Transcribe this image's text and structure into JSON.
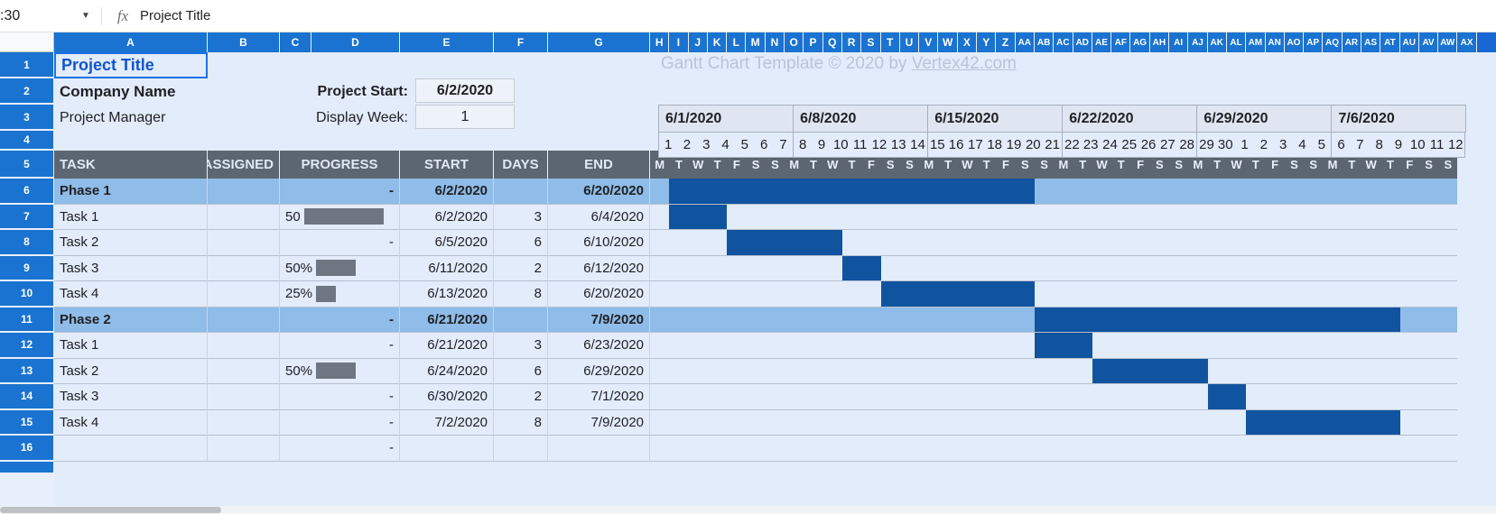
{
  "formula_bar": {
    "name_box": ":30",
    "dropdown_icon": "chevron-down-icon",
    "fx_icon": "fx-icon",
    "content": "Project Title"
  },
  "columns": [
    "A",
    "B",
    "C",
    "D",
    "E",
    "F",
    "G",
    "H",
    "I",
    "J",
    "K",
    "L",
    "M",
    "N",
    "O",
    "P",
    "Q",
    "R",
    "S",
    "T",
    "U",
    "V",
    "W",
    "X",
    "Y",
    "Z",
    "AA",
    "AB",
    "AC",
    "AD",
    "AE",
    "AF",
    "AG",
    "AH",
    "AI",
    "AJ",
    "AK",
    "AL",
    "AM",
    "AN",
    "AO",
    "AP",
    "AQ",
    "AR",
    "AS",
    "AT",
    "AU",
    "AV",
    "AW",
    "AX"
  ],
  "rows": [
    "1",
    "2",
    "3",
    "4",
    "5",
    "6",
    "7",
    "8",
    "9",
    "10",
    "11",
    "12",
    "13",
    "14",
    "15",
    "16"
  ],
  "watermark": {
    "prefix": "Gantt Chart Template © 2020 by ",
    "link": "Vertex42.com"
  },
  "header_block": {
    "project_title": "Project Title",
    "company_name": "Company Name",
    "project_manager": "Project Manager",
    "project_start_label": "Project Start:",
    "project_start_value": "6/2/2020",
    "display_week_label": "Display Week:",
    "display_week_value": "1"
  },
  "table_headers": {
    "task": "TASK",
    "assigned": "ASSIGNED",
    "progress": "PROGRESS",
    "start": "START",
    "days": "DAYS",
    "end": "END"
  },
  "weeks": [
    {
      "label": "6/1/2020",
      "days": [
        "1",
        "2",
        "3",
        "4",
        "5",
        "6",
        "7"
      ],
      "dow": [
        "M",
        "T",
        "W",
        "T",
        "F",
        "S",
        "S"
      ]
    },
    {
      "label": "6/8/2020",
      "days": [
        "8",
        "9",
        "10",
        "11",
        "12",
        "13",
        "14"
      ],
      "dow": [
        "M",
        "T",
        "W",
        "T",
        "F",
        "S",
        "S"
      ]
    },
    {
      "label": "6/15/2020",
      "days": [
        "15",
        "16",
        "17",
        "18",
        "19",
        "20",
        "21"
      ],
      "dow": [
        "M",
        "T",
        "W",
        "T",
        "F",
        "S",
        "S"
      ]
    },
    {
      "label": "6/22/2020",
      "days": [
        "22",
        "23",
        "24",
        "25",
        "26",
        "27",
        "28"
      ],
      "dow": [
        "M",
        "T",
        "W",
        "T",
        "F",
        "S",
        "S"
      ]
    },
    {
      "label": "6/29/2020",
      "days": [
        "29",
        "30",
        "1",
        "2",
        "3",
        "4",
        "5"
      ],
      "dow": [
        "M",
        "T",
        "W",
        "T",
        "F",
        "S",
        "S"
      ]
    },
    {
      "label": "7/6/2020",
      "days": [
        "6",
        "7",
        "8",
        "9",
        "10",
        "11",
        "12"
      ],
      "dow": [
        "M",
        "T",
        "W",
        "T",
        "F",
        "S",
        "S"
      ]
    }
  ],
  "tasks": [
    {
      "row": "6",
      "type": "phase",
      "task": "Phase 1",
      "assigned": "",
      "progress_text": "-",
      "progress_pct": null,
      "start": "6/2/2020",
      "days": "",
      "end": "6/20/2020",
      "bar_start_day": 2,
      "bar_len": 19
    },
    {
      "row": "7",
      "type": "task",
      "task": "Task 1",
      "assigned": "",
      "progress_text": "50",
      "progress_pct": 50,
      "start": "6/2/2020",
      "days": "3",
      "end": "6/4/2020",
      "bar_start_day": 2,
      "bar_len": 3
    },
    {
      "row": "8",
      "type": "task",
      "task": "Task 2",
      "assigned": "",
      "progress_text": "-",
      "progress_pct": null,
      "start": "6/5/2020",
      "days": "6",
      "end": "6/10/2020",
      "bar_start_day": 5,
      "bar_len": 6
    },
    {
      "row": "9",
      "type": "task",
      "task": "Task 3",
      "assigned": "",
      "progress_text": "50%",
      "progress_pct": 50,
      "start": "6/11/2020",
      "days": "2",
      "end": "6/12/2020",
      "bar_start_day": 11,
      "bar_len": 2
    },
    {
      "row": "10",
      "type": "task",
      "task": "Task 4",
      "assigned": "",
      "progress_text": "25%",
      "progress_pct": 25,
      "start": "6/13/2020",
      "days": "8",
      "end": "6/20/2020",
      "bar_start_day": 13,
      "bar_len": 8
    },
    {
      "row": "11",
      "type": "phase",
      "task": "Phase 2",
      "assigned": "",
      "progress_text": "-",
      "progress_pct": null,
      "start": "6/21/2020",
      "days": "",
      "end": "7/9/2020",
      "bar_start_day": 21,
      "bar_len": 19
    },
    {
      "row": "12",
      "type": "task",
      "task": "Task 1",
      "assigned": "",
      "progress_text": "-",
      "progress_pct": null,
      "start": "6/21/2020",
      "days": "3",
      "end": "6/23/2020",
      "bar_start_day": 21,
      "bar_len": 3
    },
    {
      "row": "13",
      "type": "task",
      "task": "Task 2",
      "assigned": "",
      "progress_text": "50%",
      "progress_pct": 50,
      "start": "6/24/2020",
      "days": "6",
      "end": "6/29/2020",
      "bar_start_day": 24,
      "bar_len": 6
    },
    {
      "row": "14",
      "type": "task",
      "task": "Task 3",
      "assigned": "",
      "progress_text": "-",
      "progress_pct": null,
      "start": "6/30/2020",
      "days": "2",
      "end": "7/1/2020",
      "bar_start_day": 30,
      "bar_len": 2
    },
    {
      "row": "15",
      "type": "task",
      "task": "Task 4",
      "assigned": "",
      "progress_text": "-",
      "progress_pct": null,
      "start": "7/2/2020",
      "days": "8",
      "end": "7/9/2020",
      "bar_start_day": 32,
      "bar_len": 8
    },
    {
      "row": "16",
      "type": "task",
      "task": "",
      "assigned": "",
      "progress_text": "-",
      "progress_pct": null,
      "start": "",
      "days": "",
      "end": "",
      "bar_start_day": null,
      "bar_len": 0
    }
  ],
  "colors": {
    "header_blue": "#1a73d0",
    "bar_blue": "#10549f",
    "phase_blue": "#8fbce8",
    "table_header_gray": "#5c6670",
    "cell_bg": "#e3ecfb",
    "progress_gray": "#6e7781",
    "title_text": "#1155cc"
  }
}
